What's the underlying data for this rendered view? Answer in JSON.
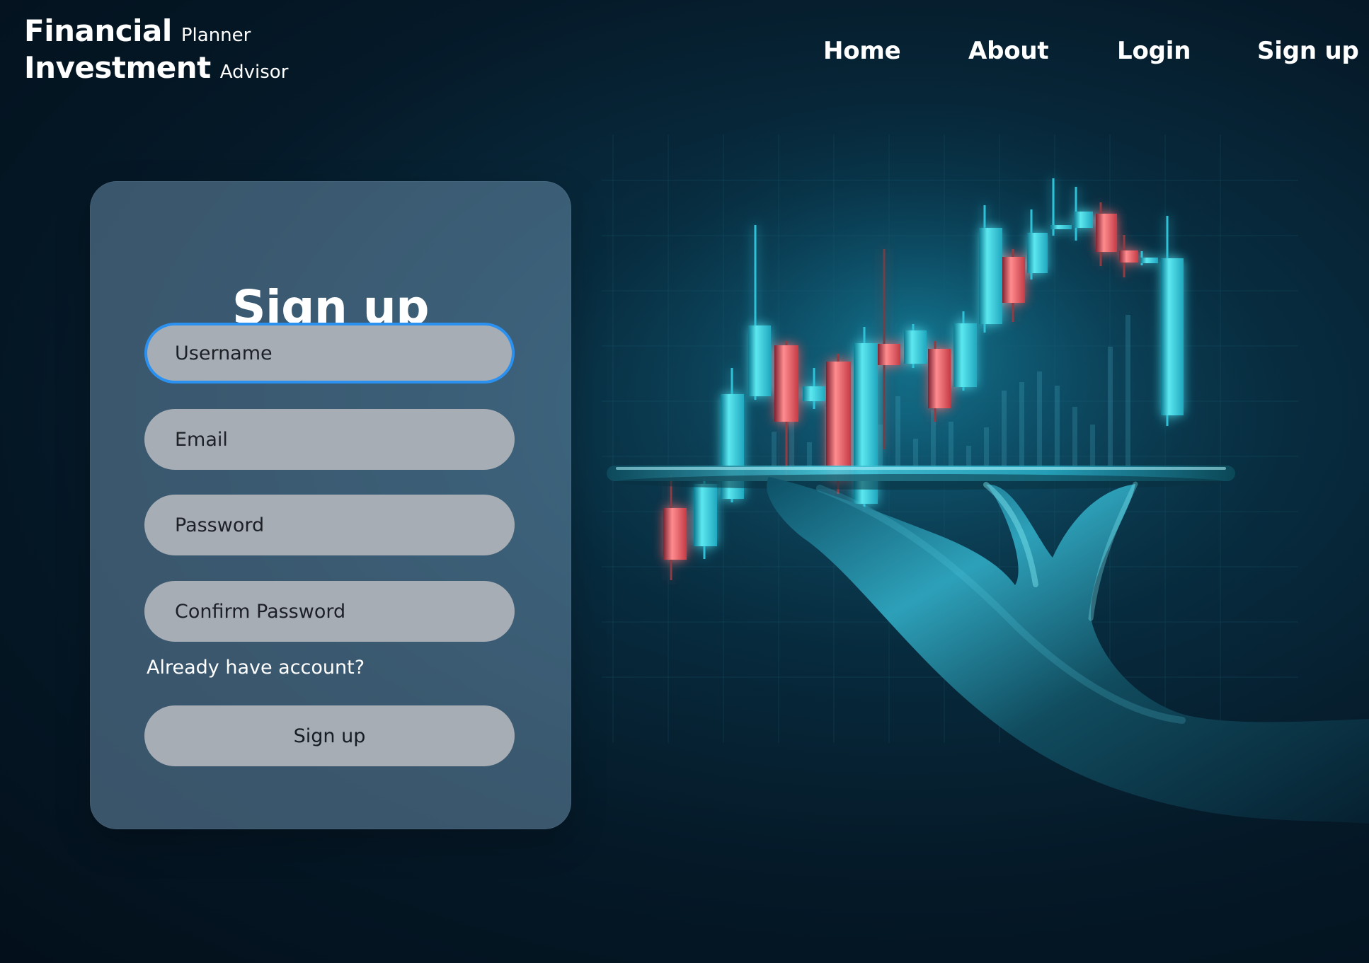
{
  "brand": {
    "line1": {
      "main": "Financial",
      "sub": "Planner"
    },
    "line2": {
      "main": "Investment",
      "sub": "Advisor"
    }
  },
  "nav": {
    "items": [
      {
        "label": "Home"
      },
      {
        "label": "About"
      },
      {
        "label": "Login"
      },
      {
        "label": "Sign up"
      }
    ]
  },
  "signup_form": {
    "title": "Sign up",
    "fields": [
      {
        "placeholder": "Username",
        "state": "focused"
      },
      {
        "placeholder": "Email",
        "state": "default"
      },
      {
        "placeholder": "Password",
        "state": "default"
      },
      {
        "placeholder": "Confirm Password",
        "state": "default"
      }
    ],
    "account_link": "Already have account?",
    "submit_label": "Sign up"
  },
  "artwork": {
    "icon": "hand-candlestick-chart-illustration",
    "colors": {
      "background": "#051623",
      "teal": "#55dce8",
      "red": "#d44d57",
      "glow": "#20d7f2"
    }
  }
}
